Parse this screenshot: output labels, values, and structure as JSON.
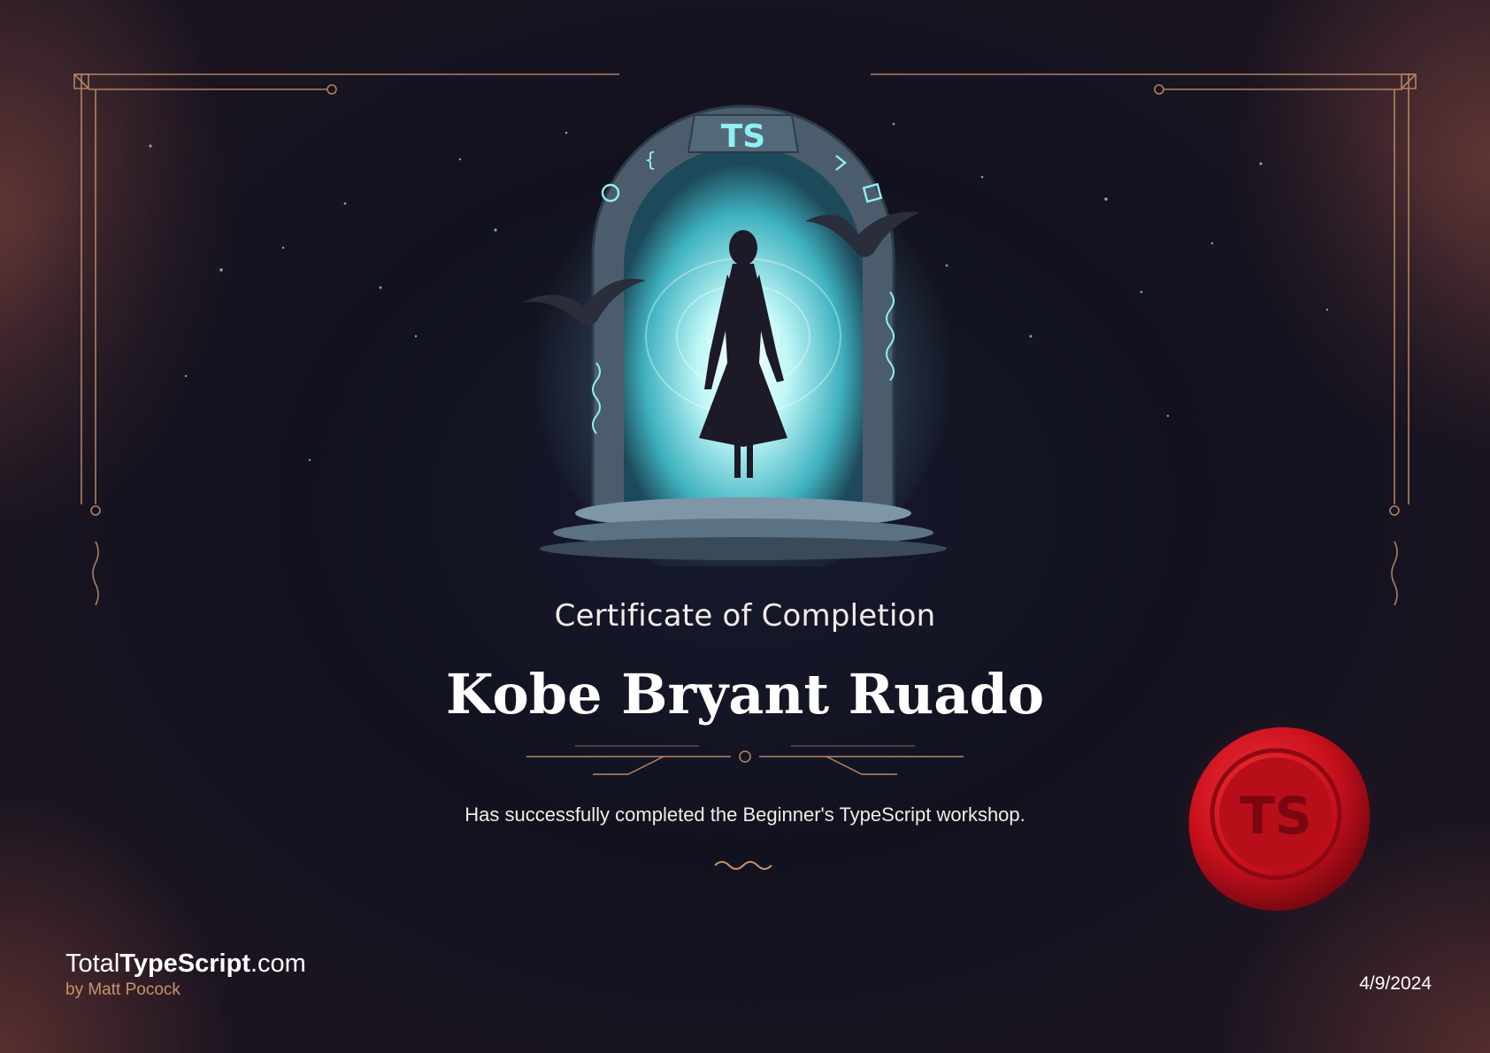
{
  "certificate": {
    "heading": "Certificate of Completion",
    "recipient": "Kobe Bryant Ruado",
    "description": "Has successfully completed the Beginner's TypeScript workshop.",
    "date": "4/9/2024"
  },
  "artwork": {
    "arch_badge": "TS",
    "icons": [
      "braces-icon",
      "circle-icon",
      "chevron-icon",
      "square-icon"
    ]
  },
  "seal": {
    "text": "TS",
    "color": "#c8101c"
  },
  "brand": {
    "name_prefix": "Total",
    "name_bold": "TypeScript",
    "name_suffix": ".com",
    "byline": "by Matt Pocock"
  },
  "colors": {
    "background": "#12121f",
    "accent_copper": "#c9936e",
    "portal_glow": "#8ff0f0"
  }
}
